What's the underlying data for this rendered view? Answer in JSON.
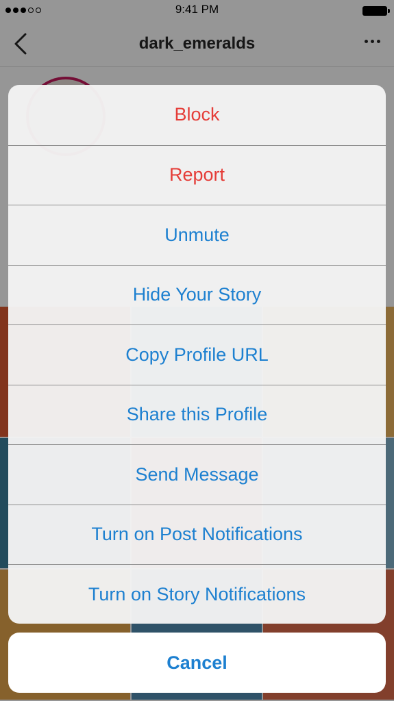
{
  "status_bar": {
    "time": "9:41 PM",
    "signal_icon": "signal-dots-icon",
    "battery_icon": "battery-icon"
  },
  "nav": {
    "title": "dark_emeralds",
    "back_icon": "chevron-left-icon",
    "more_icon": "more-dots-icon"
  },
  "profile": {
    "photo_colors": [
      "#d9572f",
      "#5a9bc3",
      "#e9b35c",
      "#3a7d99",
      "#c9473b",
      "#7fb0c9",
      "#e0a24a",
      "#4f89ad",
      "#d96a4a"
    ]
  },
  "action_sheet": {
    "items": [
      {
        "label": "Block",
        "style": "destructive"
      },
      {
        "label": "Report",
        "style": "destructive"
      },
      {
        "label": "Unmute",
        "style": "default"
      },
      {
        "label": "Hide Your Story",
        "style": "default"
      },
      {
        "label": "Copy Profile URL",
        "style": "default"
      },
      {
        "label": "Share this Profile",
        "style": "default"
      },
      {
        "label": "Send Message",
        "style": "default"
      },
      {
        "label": "Turn on Post Notifications",
        "style": "default"
      },
      {
        "label": "Turn on Story Notifications",
        "style": "default"
      }
    ],
    "cancel_label": "Cancel"
  },
  "colors": {
    "action_blue": "#1d80d0",
    "destructive_red": "#e53d38",
    "avatar_ring": "#c2185b"
  }
}
